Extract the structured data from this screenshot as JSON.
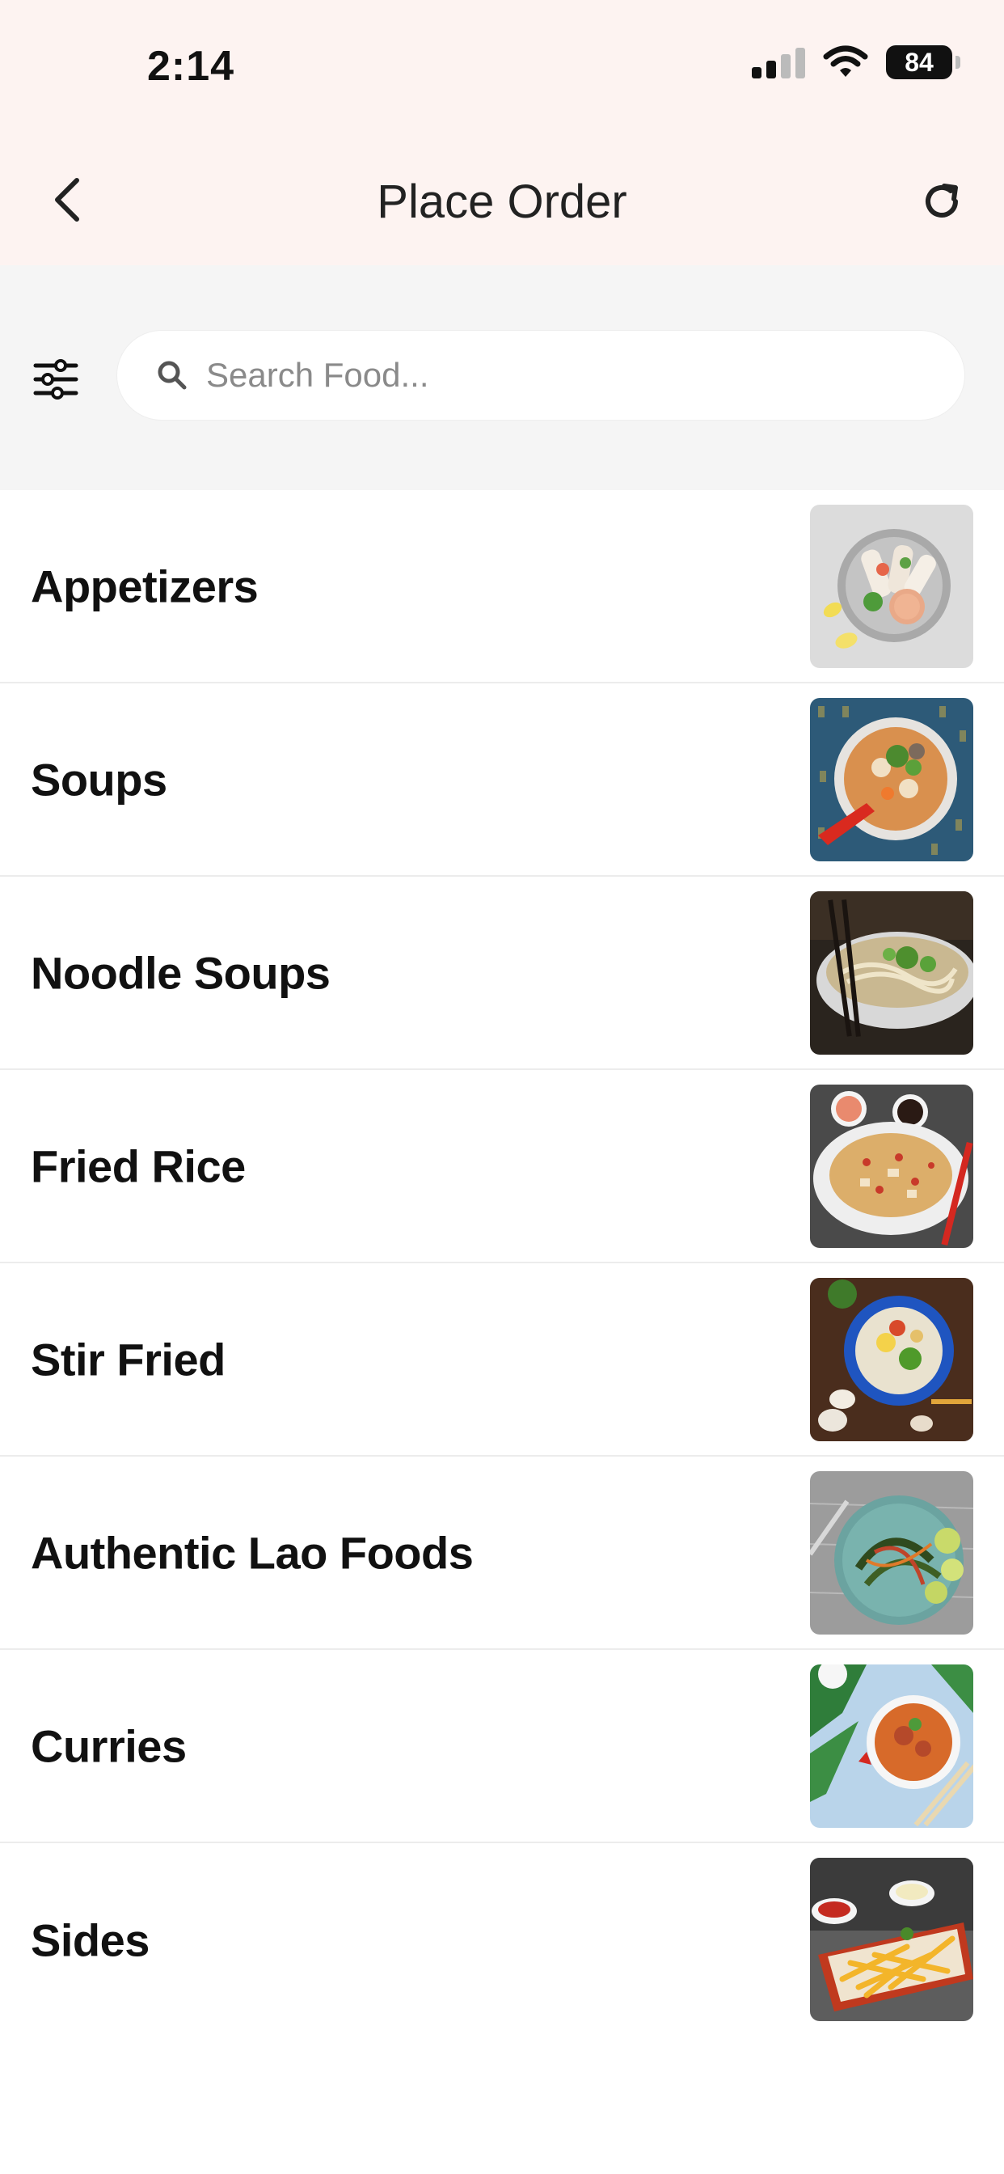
{
  "status_bar": {
    "time": "2:14",
    "battery": "84",
    "icons": [
      "cellular-signal-icon",
      "wifi-icon",
      "battery-icon"
    ]
  },
  "header": {
    "title": "Place Order",
    "back_icon": "chevron-left-icon",
    "refresh_icon": "refresh-icon"
  },
  "search": {
    "placeholder": "Search Food...",
    "value": "",
    "filter_icon": "sliders-icon",
    "search_icon": "search-icon"
  },
  "categories": [
    {
      "label": "Appetizers",
      "image": "spring-rolls-plate"
    },
    {
      "label": "Soups",
      "image": "tom-yum-bowl"
    },
    {
      "label": "Noodle Soups",
      "image": "pho-bowl-chopsticks"
    },
    {
      "label": "Fried Rice",
      "image": "fried-rice-plate"
    },
    {
      "label": "Stir Fried",
      "image": "stir-fry-blue-bowl"
    },
    {
      "label": "Authentic Lao Foods",
      "image": "lao-green-plate"
    },
    {
      "label": "Curries",
      "image": "red-curry-bowl"
    },
    {
      "label": "Sides",
      "image": "french-fries-dish"
    }
  ],
  "colors": {
    "header_bg": "#fdf3f1",
    "search_area_bg": "#f5f5f5",
    "text_primary": "#111111",
    "divider": "#ececec"
  }
}
